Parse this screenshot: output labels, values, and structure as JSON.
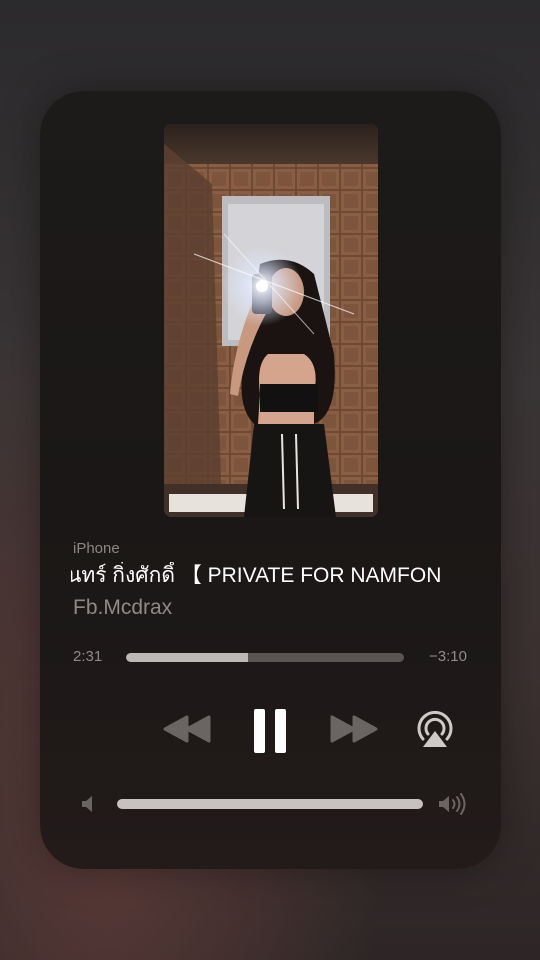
{
  "now_playing": {
    "source_device": "iPhone",
    "title": "นทร์ กิ่งศักดิ์ 【 PRIVATE FOR NAMFON",
    "artist": "Fb.Mcdrax",
    "elapsed": "2:31",
    "remaining": "−3:10",
    "progress": 0.44,
    "volume": 1.0
  },
  "controls": {
    "rewind_icon": "rewind-icon",
    "pause_icon": "pause-icon",
    "forward_icon": "fast-forward-icon",
    "airplay_icon": "airplay-icon",
    "volume_low_icon": "speaker-low-icon",
    "volume_high_icon": "speaker-high-icon"
  },
  "colors": {
    "accent": "#ffffff",
    "secondary_text": "#8f8a88",
    "card_bg": "#1d1a1a"
  }
}
